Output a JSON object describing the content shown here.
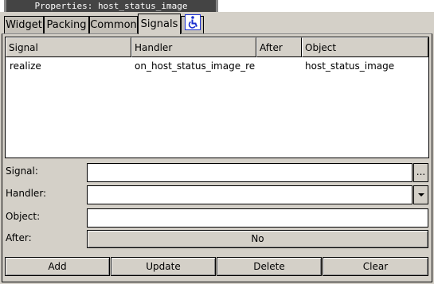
{
  "window": {
    "title": "Properties: host_status_image"
  },
  "tabs": [
    {
      "label": "Widget"
    },
    {
      "label": "Packing"
    },
    {
      "label": "Common"
    },
    {
      "label": "Signals"
    }
  ],
  "active_tab": "Signals",
  "accessibility_tab_icon": "wheelchair-icon",
  "signals_list": {
    "columns": [
      "Signal",
      "Handler",
      "After",
      "Object"
    ],
    "rows": [
      {
        "signal": "realize",
        "handler": "on_host_status_image_re",
        "after": "",
        "object": "host_status_image"
      }
    ]
  },
  "form": {
    "signal_label": "Signal:",
    "signal_value": "",
    "signal_browse_label": "...",
    "handler_label": "Handler:",
    "handler_value": "",
    "object_label": "Object:",
    "object_value": "",
    "after_label": "After:",
    "after_value": "No"
  },
  "actions": {
    "add": "Add",
    "update": "Update",
    "delete": "Delete",
    "clear": "Clear"
  },
  "colors": {
    "background": "#d4d0c8",
    "title_bar": "#444444",
    "accessibility_icon": "#1a2fd0"
  }
}
